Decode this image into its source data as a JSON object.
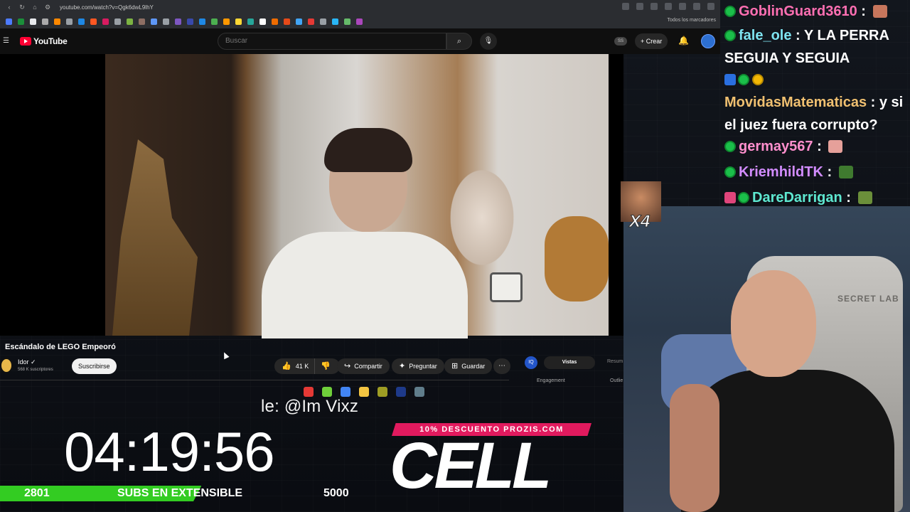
{
  "browser": {
    "url": "youtube.com/watch?v=Qgk6dwL9lhY",
    "bookmarks_folder_label": "Todos los marcadores",
    "bookmark_colors": [
      "#4d7bff",
      "#1b8f3a",
      "#e8eaed",
      "#aaaaaa",
      "#ff8800",
      "#9aa0a6",
      "#1e88e5",
      "#ff5722",
      "#d81b60",
      "#9aa0a6",
      "#7cb342",
      "#8d6e63",
      "#5e97f6",
      "#9aa0a6",
      "#7e57c2",
      "#3949ab",
      "#1e88e5",
      "#4caf50",
      "#ff9800",
      "#fdd835",
      "#26a69a",
      "#ffffff",
      "#ef6c00",
      "#e64a19",
      "#42a5f5",
      "#e53935",
      "#9aa0a6",
      "#29b6f6",
      "#66bb6a",
      "#ab47bc"
    ]
  },
  "youtube": {
    "logo_text": "YouTube",
    "search_placeholder": "Buscar",
    "badge_text": "SS",
    "create_label": "Crear",
    "video_title": "Escándalo de LEGO Empeoró",
    "channel_name": "Idor",
    "channel_subs": "568 K suscriptores",
    "subscribe_label": "Suscribirse",
    "likes": "41 K",
    "share_label": "Compartir",
    "ask_label": "Preguntar",
    "save_label": "Guardar",
    "extension": {
      "icon_text": "IQ",
      "tab_active": "Vistas",
      "tab_other": "Resum",
      "label_left": "Engagement",
      "label_right": "Outlie"
    }
  },
  "overlay": {
    "ticker_text": "le: @Im Vixz",
    "timer": "04:19:56",
    "subs_current": "2801",
    "subs_label": "SUBS EN EXTENSIBLE",
    "subs_goal": "5000",
    "subs_progress": 0.5602,
    "promo_text": "10% DESCUENTO PROZIS.COM",
    "sponsor": "CELL",
    "chair_brand": "SECRET LAB",
    "emote_text": "X4",
    "taskbar_colors": [
      "#e53935",
      "#6fcf3a",
      "#4285f4",
      "#f4c542",
      "#9e9d24",
      "#1e3a8a",
      "#607d8b"
    ]
  },
  "chat": [
    {
      "user": "GoblinGuard3610",
      "text": ""
    },
    {
      "user": "fale_ole",
      "text": "Y LA PERRA SEGUIA Y SEGUIA"
    },
    {
      "user": "MovidasMatematicas",
      "text": "y si el juez fuera corrupto?"
    },
    {
      "user": "germay567",
      "text": ""
    },
    {
      "user": "KriemhildTK",
      "text": ""
    },
    {
      "user": "DareDarrigan",
      "text": ""
    }
  ]
}
